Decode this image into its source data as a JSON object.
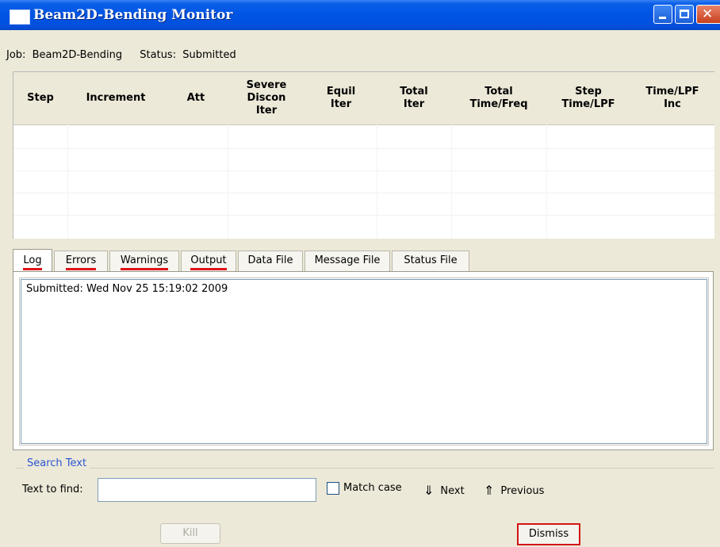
{
  "window": {
    "title": "Beam2D-Bending Monitor"
  },
  "job": {
    "job_label": "Job:",
    "job_name": "Beam2D-Bending",
    "status_label": "Status:",
    "status_value": "Submitted"
  },
  "table": {
    "columns": [
      "Step",
      "Increment",
      "Att",
      "Severe Discon Iter",
      "Equil Iter",
      "Total Iter",
      "Total Time/Freq",
      "Step Time/LPF",
      "Time/LPF Inc"
    ],
    "rows": []
  },
  "tabs": [
    {
      "label": "Log",
      "underlined": true,
      "active": true
    },
    {
      "label": "Errors",
      "underlined": true,
      "active": false
    },
    {
      "label": "Warnings",
      "underlined": true,
      "active": false
    },
    {
      "label": "Output",
      "underlined": true,
      "active": false
    },
    {
      "label": "Data File",
      "underlined": false,
      "active": false
    },
    {
      "label": "Message File",
      "underlined": false,
      "active": false
    },
    {
      "label": "Status File",
      "underlined": false,
      "active": false
    }
  ],
  "log": {
    "text": "Submitted: Wed Nov 25 15:19:02 2009"
  },
  "search": {
    "group_label": "Search Text",
    "find_label": "Text to find:",
    "find_value": "",
    "match_case_label": "Match case",
    "match_case_checked": false,
    "next_label": "Next",
    "previous_label": "Previous"
  },
  "buttons": {
    "kill_label": "Kill",
    "dismiss_label": "Dismiss"
  },
  "colors": {
    "titlebar": "#0054e3",
    "highlight": "#e0141a",
    "search_legend": "#2a55d4"
  }
}
